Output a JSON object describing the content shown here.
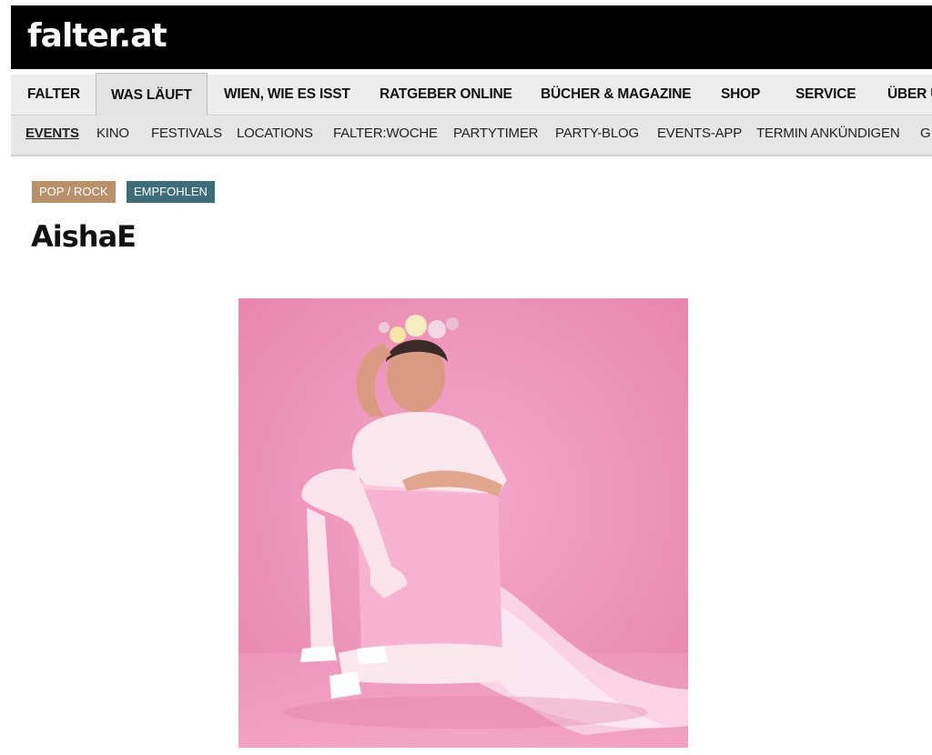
{
  "site": {
    "logo": "falter.at"
  },
  "main_nav": {
    "items": [
      "FALTER",
      "WAS LÄUFT",
      "WIEN, WIE ES ISST",
      "RATGEBER ONLINE",
      "BÜCHER & MAGAZINE",
      "SHOP",
      "SERVICE",
      "ÜBER U"
    ],
    "active": "WAS LÄUFT"
  },
  "sub_nav": {
    "items": [
      "EVENTS",
      "KINO",
      "FESTIVALS",
      "LOCATIONS",
      "FALTER:WOCHE",
      "PARTYTIMER",
      "PARTY-BLOG",
      "EVENTS-APP",
      "TERMIN ANKÜNDIGEN",
      "G"
    ],
    "active": "EVENTS"
  },
  "tags": [
    {
      "label": "POP / ROCK",
      "color": "#b8906a"
    },
    {
      "label": "EMPFOHLEN",
      "color": "#3d6d78"
    }
  ],
  "event": {
    "title": "AishaE"
  },
  "colors": {
    "topbar": "#000000",
    "photo_bg": "#ec8fb6"
  }
}
